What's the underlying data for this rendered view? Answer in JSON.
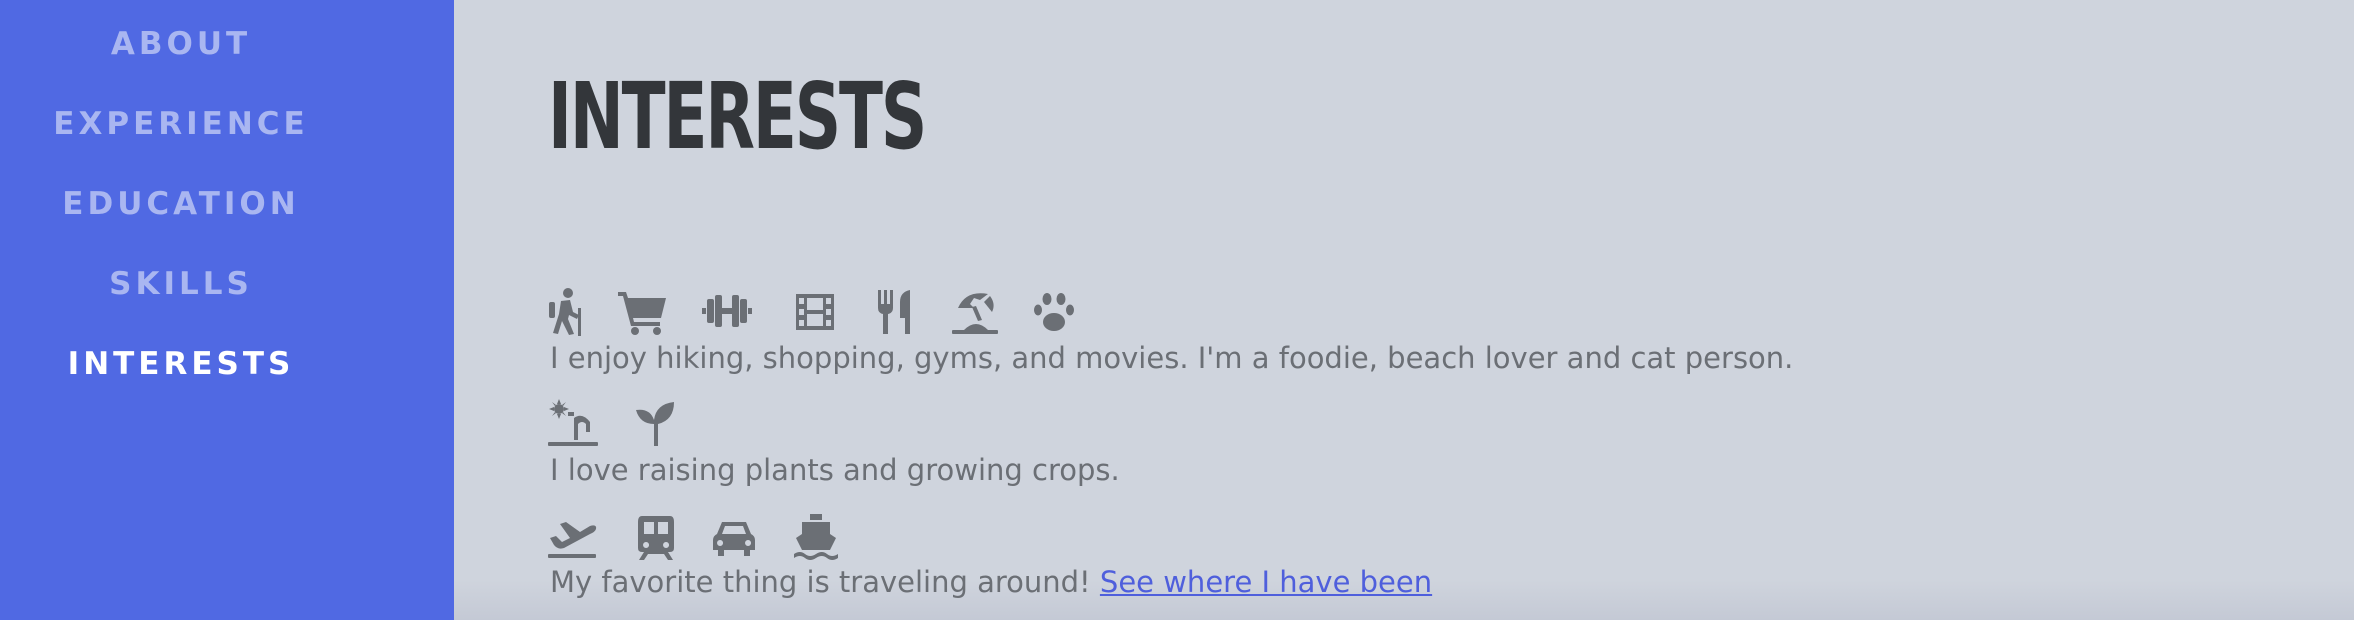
{
  "nav": {
    "items": [
      {
        "label": "ABOUT"
      },
      {
        "label": "EXPERIENCE"
      },
      {
        "label": "EDUCATION"
      },
      {
        "label": "SKILLS"
      },
      {
        "label": "INTERESTS"
      }
    ],
    "active": "INTERESTS"
  },
  "main": {
    "title": "INTERESTS",
    "sections": [
      {
        "icons": [
          "hiking-icon",
          "shopping-cart-icon",
          "dumbbell-icon",
          "film-icon",
          "utensils-icon",
          "umbrella-beach-icon",
          "paw-icon"
        ],
        "text": "I enjoy hiking, shopping, gyms, and movies. I'm a foodie, beach lover and cat person."
      },
      {
        "icons": [
          "farm-icon",
          "seedling-icon"
        ],
        "text": "I love raising plants and growing crops."
      },
      {
        "icons": [
          "plane-departure-icon",
          "train-icon",
          "car-icon",
          "ship-icon"
        ],
        "text": "My favorite thing is traveling around!",
        "link": "See where I have been"
      }
    ]
  },
  "colors": {
    "sidebar_bg": "#5069e3",
    "nav_inactive": "#a9b6f1",
    "nav_active": "#ffffff",
    "main_bg": "#cfd4dd",
    "title": "#33363a",
    "body_text": "#6b6f75",
    "icon": "#6b6f75",
    "link": "#4f5fdc"
  }
}
